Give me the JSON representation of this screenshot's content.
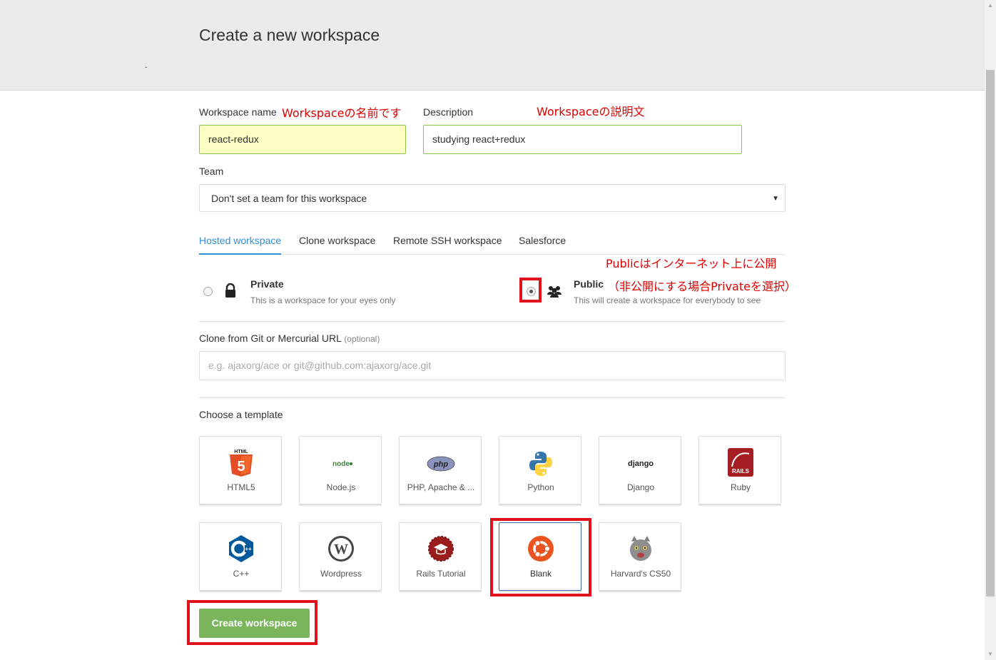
{
  "page": {
    "title": "Create a new workspace",
    "dot": "."
  },
  "form": {
    "name_label": "Workspace name",
    "name_value": "react-redux",
    "desc_label": "Description",
    "desc_value": "studying react+redux",
    "team_label": "Team",
    "team_value": "Don't set a team for this workspace"
  },
  "annotations": {
    "name_note": "Workspaceの名前です",
    "desc_note": "Workspaceの説明文",
    "public_note": "Publicはインターネット上に公開",
    "private_note": "（非公開にする場合Privateを選択）"
  },
  "tabs": [
    {
      "label": "Hosted workspace",
      "active": true
    },
    {
      "label": "Clone workspace",
      "active": false
    },
    {
      "label": "Remote SSH workspace",
      "active": false
    },
    {
      "label": "Salesforce",
      "active": false
    }
  ],
  "visibility": {
    "private_title": "Private",
    "private_sub": "This is a workspace for your eyes only",
    "public_title": "Public",
    "public_sub": "This will create a workspace for everybody to see",
    "selected": "public"
  },
  "clone": {
    "label": "Clone from Git or Mercurial URL",
    "optional": "(optional)",
    "placeholder": "e.g. ajaxorg/ace or git@github.com:ajaxorg/ace.git"
  },
  "templates": {
    "label": "Choose a template",
    "items": [
      {
        "label": "HTML5",
        "icon": "html5-icon"
      },
      {
        "label": "Node.js",
        "icon": "nodejs-icon"
      },
      {
        "label": "PHP, Apache & ...",
        "icon": "php-icon"
      },
      {
        "label": "Python",
        "icon": "python-icon"
      },
      {
        "label": "Django",
        "icon": "django-icon"
      },
      {
        "label": "Ruby",
        "icon": "rails-icon"
      },
      {
        "label": "C++",
        "icon": "cpp-icon"
      },
      {
        "label": "Wordpress",
        "icon": "wordpress-icon"
      },
      {
        "label": "Rails Tutorial",
        "icon": "rails-tutorial-icon"
      },
      {
        "label": "Blank",
        "icon": "ubuntu-icon",
        "selected": true
      },
      {
        "label": "Harvard's CS50",
        "icon": "cs50-cat-icon"
      }
    ]
  },
  "actions": {
    "create_label": "Create workspace"
  },
  "colors": {
    "accent": "#2f8fd8",
    "highlight": "#e2121d",
    "create": "#7ab55c",
    "name_bg": "#fbfdc3"
  }
}
